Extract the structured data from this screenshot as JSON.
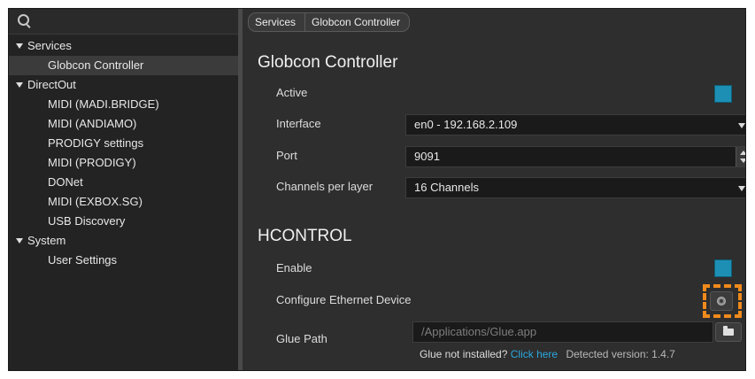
{
  "sidebar": {
    "search": {
      "placeholder": ""
    },
    "groups": [
      {
        "label": "Services",
        "items": [
          "Globcon Controller"
        ]
      },
      {
        "label": "DirectOut",
        "items": [
          "MIDI (MADI.BRIDGE)",
          "MIDI (ANDIAMO)",
          "PRODIGY settings",
          "MIDI (PRODIGY)",
          "DONet",
          "MIDI (EXBOX.SG)",
          "USB Discovery"
        ]
      },
      {
        "label": "System",
        "items": [
          "User Settings"
        ]
      }
    ],
    "selected_item": "Globcon Controller"
  },
  "breadcrumb": [
    "Services",
    "Globcon Controller"
  ],
  "globcon": {
    "title": "Globcon Controller",
    "active_label": "Active",
    "active_checked": true,
    "interface_label": "Interface",
    "interface_value": "en0 - 192.168.2.109",
    "port_label": "Port",
    "port_value": "9091",
    "channels_label": "Channels per layer",
    "channels_value": "16 Channels"
  },
  "hcontrol": {
    "title": "HCONTROL",
    "enable_label": "Enable",
    "enable_checked": true,
    "configure_label": "Configure Ethernet Device",
    "glue_path_label": "Glue Path",
    "glue_path_value": "/Applications/Glue.app",
    "glue_note_text": "Glue not installed?",
    "glue_link_text": "Click here",
    "detected_version": "Detected version: 1.4.7"
  },
  "colors": {
    "accent": "#1d8fb5",
    "link": "#29a8e0",
    "highlight": "#f08a1c",
    "background": "#2e2e2e",
    "sidebar_background": "#232323"
  },
  "icons": {
    "search": "search-icon",
    "expand": "caret-down-icon",
    "dropdown": "chevron-down-icon",
    "stepper": "stepper-arrows-icon",
    "configure": "gear-icon",
    "browse": "folder-icon"
  }
}
